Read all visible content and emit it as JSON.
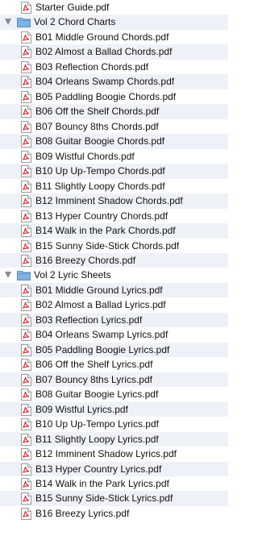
{
  "items": [
    {
      "type": "file",
      "name": "Starter Guide.pdf"
    },
    {
      "type": "folder",
      "name": "Vol 2 Chord Charts"
    },
    {
      "type": "file",
      "name": "B01 Middle Ground Chords.pdf"
    },
    {
      "type": "file",
      "name": "B02 Almost a Ballad Chords.pdf"
    },
    {
      "type": "file",
      "name": "B03 Reflection Chords.pdf"
    },
    {
      "type": "file",
      "name": "B04 Orleans Swamp Chords.pdf"
    },
    {
      "type": "file",
      "name": "B05 Paddling Boogie Chords.pdf"
    },
    {
      "type": "file",
      "name": "B06 Off the Shelf Chords.pdf"
    },
    {
      "type": "file",
      "name": "B07 Bouncy 8ths Chords.pdf"
    },
    {
      "type": "file",
      "name": "B08 Guitar Boogie Chords.pdf"
    },
    {
      "type": "file",
      "name": "B09 Wistful Chords.pdf"
    },
    {
      "type": "file",
      "name": "B10 Up Up-Tempo Chords.pdf"
    },
    {
      "type": "file",
      "name": "B11 Slightly Loopy Chords.pdf"
    },
    {
      "type": "file",
      "name": "B12 Imminent Shadow Chords.pdf"
    },
    {
      "type": "file",
      "name": "B13 Hyper Country Chords.pdf"
    },
    {
      "type": "file",
      "name": "B14 Walk in the Park Chords.pdf"
    },
    {
      "type": "file",
      "name": "B15 Sunny Side-Stick Chords.pdf"
    },
    {
      "type": "file",
      "name": "B16 Breezy Chords.pdf"
    },
    {
      "type": "folder",
      "name": "Vol 2 Lyric Sheets"
    },
    {
      "type": "file",
      "name": "B01 Middle Ground Lyrics.pdf"
    },
    {
      "type": "file",
      "name": "B02 Almost a Ballad Lyrics.pdf"
    },
    {
      "type": "file",
      "name": "B03 Reflection Lyrics.pdf"
    },
    {
      "type": "file",
      "name": "B04 Orleans Swamp Lyrics.pdf"
    },
    {
      "type": "file",
      "name": "B05 Paddling Boogie Lyrics.pdf"
    },
    {
      "type": "file",
      "name": "B06 Off the Shelf Lyrics.pdf"
    },
    {
      "type": "file",
      "name": "B07 Bouncy 8ths Lyrics.pdf"
    },
    {
      "type": "file",
      "name": "B08 Guitar Boogie Lyrics.pdf"
    },
    {
      "type": "file",
      "name": "B09 Wistful Lyrics.pdf"
    },
    {
      "type": "file",
      "name": "B10 Up Up-Tempo Lyrics.pdf"
    },
    {
      "type": "file",
      "name": "B11 Slightly Loopy Lyrics.pdf"
    },
    {
      "type": "file",
      "name": "B12 Imminent Shadow Lyrics.pdf"
    },
    {
      "type": "file",
      "name": "B13 Hyper Country Lyrics.pdf"
    },
    {
      "type": "file",
      "name": "B14 Walk in the Park Lyrics.pdf"
    },
    {
      "type": "file",
      "name": "B15 Sunny Side-Stick Lyrics.pdf"
    },
    {
      "type": "file",
      "name": "B16 Breezy Lyrics.pdf"
    }
  ],
  "colors": {
    "row_alternate": "#eef2f8",
    "pdf_red": "#d8262b",
    "folder_blue": "#6fa8dc",
    "disclosure_gray": "#8a8a8a"
  },
  "icons": {
    "file": "pdf-file-icon",
    "folder": "folder-icon",
    "expander": "disclosure-triangle-expanded-icon"
  }
}
